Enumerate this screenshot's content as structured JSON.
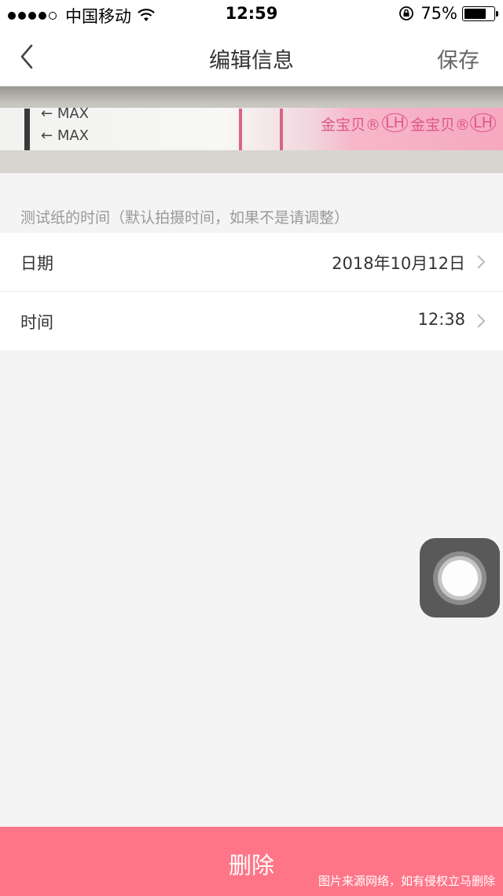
{
  "status_bar": {
    "carrier": "中国移动",
    "time": "12:59",
    "battery_percent": "75%",
    "battery_level": 0.75,
    "icons": [
      "signal-dots-icon",
      "wifi-icon",
      "rotation-lock-icon",
      "battery-icon"
    ]
  },
  "nav": {
    "title": "编辑信息",
    "save_label": "保存",
    "back_icon": "chevron-left-icon"
  },
  "photo": {
    "max_label_1": "MAX",
    "max_label_2": "MAX",
    "brand_text_1": "金宝贝®",
    "lh_1": "LH",
    "brand_text_2": "金宝贝®",
    "lh_2": "LH"
  },
  "section_note": "测试纸的时间（默认拍摄时间，如果不是请调整）",
  "rows": [
    {
      "label": "日期",
      "value": "2018年10月12日"
    },
    {
      "label": "时间",
      "value": "12:38"
    }
  ],
  "delete_button": {
    "label": "删除",
    "color": "#ff7588"
  },
  "watermark": "图片来源网络，如有侵权立马删除"
}
